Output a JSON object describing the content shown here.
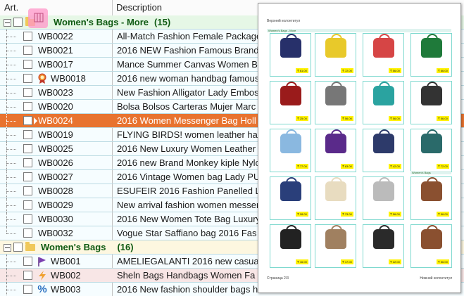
{
  "columns": {
    "art": "Art.",
    "description": "Description"
  },
  "groups": [
    {
      "title": "Women's Bags - More",
      "count": "(15)"
    },
    {
      "title": "Women's Bags",
      "count": "(16)"
    }
  ],
  "rows": [
    {
      "art": "WB0022",
      "description": "All-Match Fashion Female Package"
    },
    {
      "art": "WB0021",
      "description": "2016 NEW Fashion Famous Brand"
    },
    {
      "art": "WB0017",
      "description": "Mance Summer Canvas Women Bag"
    },
    {
      "art": "WB0018",
      "description": "2016 new woman handbag famous"
    },
    {
      "art": "WB0023",
      "description": "New Fashion Alligator Lady Embos"
    },
    {
      "art": "WB0020",
      "description": "Bolsa Bolsos Carteras Mujer Marc"
    },
    {
      "art": "WB0024",
      "description": "2016 Women Messenger Bag Holl"
    },
    {
      "art": "WB0019",
      "description": "FLYING BIRDS! women leather han"
    },
    {
      "art": "WB0025",
      "description": "2016 New Luxury Women Leather"
    },
    {
      "art": "WB0026",
      "description": "2016 new Brand Monkey kiple Nylo"
    },
    {
      "art": "WB0027",
      "description": "2016 Vintage Women bag Lady PU"
    },
    {
      "art": "WB0028",
      "description": "ESUFEIR 2016 Fashion Panelled L"
    },
    {
      "art": "WB0029",
      "description": "New arrival fashion women messer"
    },
    {
      "art": "WB0030",
      "description": "2016 New Women Tote Bag Luxury"
    },
    {
      "art": "WB0032",
      "description": "Vogue Star Saffiano bag 2016 Fas"
    },
    {
      "art": "WB001",
      "description": "AMELIEGALANTI 2016 new casua"
    },
    {
      "art": "WB002",
      "description": "Sheln Bags Handbags Women Fa"
    },
    {
      "art": "WB003",
      "description": "2016 New fashion shoulder bags h"
    }
  ],
  "preview": {
    "header": "Верхний колонтитул",
    "section1": "Women's Bags - More",
    "section2": "Women's Bags",
    "footer_left": "Страница 2/3",
    "footer_right": "Нижний колонтитул",
    "prices": [
      "₹ 61.00",
      "₹ 72.00",
      "₹ 56.00",
      "₹ 66.00",
      "₹ 25.00",
      "₹ 56.00",
      "₹ 56.00",
      "₹ 56.00",
      "₹ 77.00",
      "₹ 63.00",
      "₹ 42.00",
      "₹ 72.00",
      "₹ 28.00",
      "₹ 73.00",
      "₹ 56.00",
      "₹ 56.00",
      "₹ 16.00",
      "₹ 17.00",
      "₹ 22.00",
      "₹ 56.00"
    ]
  },
  "colors": {
    "selected_row": "#e8732f",
    "group_title": "#0f5a12",
    "card_border": "#7fd9cf",
    "price_bg": "#fff200"
  }
}
